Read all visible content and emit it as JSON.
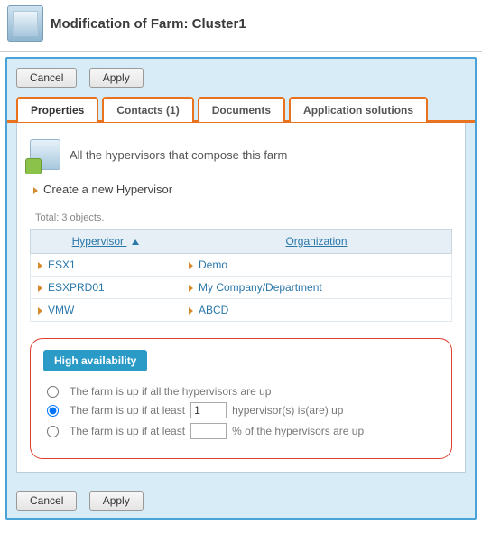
{
  "header": {
    "title": "Modification of Farm: Cluster1"
  },
  "buttons": {
    "cancel": "Cancel",
    "apply": "Apply"
  },
  "tabs": {
    "properties": "Properties",
    "contacts": "Contacts (1)",
    "documents": "Documents",
    "solutions": "Application solutions"
  },
  "intro": {
    "text": "All the hypervisors that compose this farm"
  },
  "create": {
    "label": "Create a new Hypervisor"
  },
  "list": {
    "total": "Total: 3 objects.",
    "headers": {
      "hypervisor": "Hypervisor",
      "organization": "Organization"
    },
    "rows": [
      {
        "hv": "ESX1",
        "org": "Demo"
      },
      {
        "hv": "ESXPRD01",
        "org": "My Company/Department"
      },
      {
        "hv": "VMW",
        "org": "ABCD"
      }
    ]
  },
  "ha": {
    "title": "High availability",
    "opt_all": "The farm is up if all the hypervisors are up",
    "opt_n_pre": "The farm is up if at least",
    "opt_n_val": "1",
    "opt_n_post": "hypervisor(s) is(are) up",
    "opt_pct_pre": "The farm is up if at least",
    "opt_pct_val": "",
    "opt_pct_post": "% of the hypervisors are up",
    "selected": "n"
  }
}
